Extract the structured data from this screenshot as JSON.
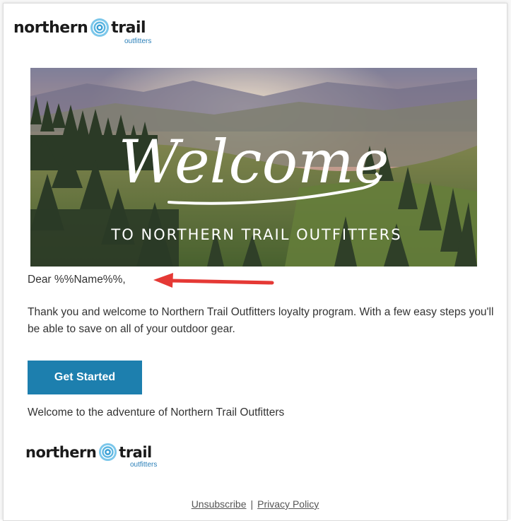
{
  "brand": {
    "logo_word_left": "northern",
    "logo_word_right": "trail",
    "logo_tagline": "outfitters",
    "accent_color": "#2a7fb8",
    "button_color": "#1d7fae"
  },
  "hero": {
    "headline": "Welcome",
    "subheadline": "TO NORTHERN TRAIL OUTFITTERS"
  },
  "email": {
    "greeting": "Dear %%Name%%,",
    "body": "Thank you and welcome to Northern Trail Outfitters loyalty program. With a few easy steps you'll be able to save on all of your outdoor gear.",
    "cta_label": "Get Started",
    "closing": "Welcome to the adventure of Northern Trail Outfitters"
  },
  "annotation": {
    "arrow_color": "#e53935",
    "arrow_icon": "arrow-left-icon"
  },
  "footer": {
    "unsubscribe": "Unsubscribe",
    "separator": "|",
    "privacy": "Privacy Policy"
  }
}
